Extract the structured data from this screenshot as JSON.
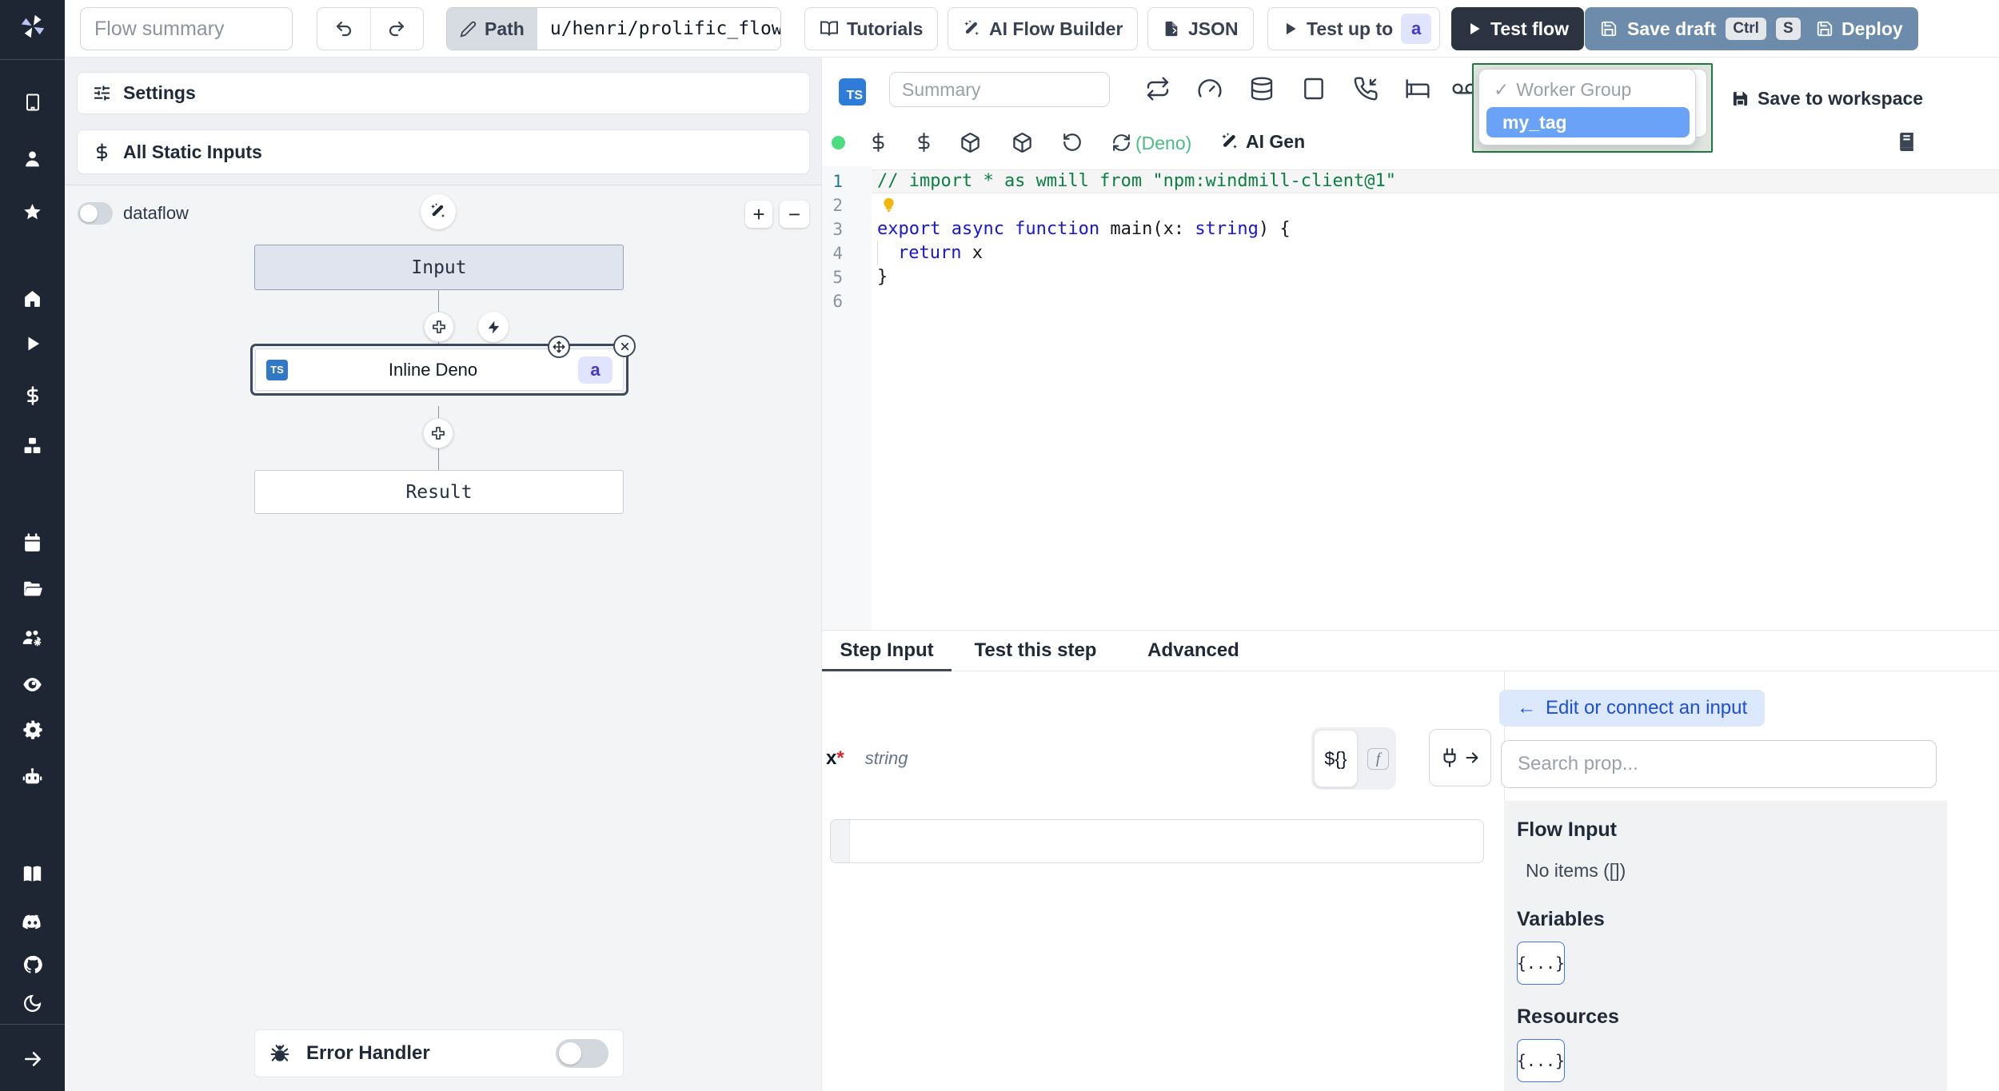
{
  "colors": {
    "sidebar_bg": "#1f2633",
    "steel_blue": "#6d8cab",
    "dark_button": "#2b3440",
    "accent_green_border": "#1c7a3f",
    "selected_option_blue": "#69a2f7",
    "indigo_chip_bg": "#e0e4fd",
    "ts_badge_blue": "#2f7cd8"
  },
  "sidebar": {
    "icons": [
      "windmill-logo",
      "building",
      "user",
      "star",
      "home",
      "play",
      "dollar",
      "boxes",
      "calendar",
      "folder-open",
      "user-group",
      "eye",
      "gear",
      "robot",
      "book",
      "discord",
      "github",
      "moon",
      "arrow-right"
    ]
  },
  "topbar": {
    "flow_summary_placeholder": "Flow summary",
    "path_label": "Path",
    "path_value": "u/henri/prolific_flow",
    "tutorials": "Tutorials",
    "ai_flow_builder": "AI Flow Builder",
    "json": "JSON",
    "test_up_to": "Test up to",
    "test_up_to_target": "a",
    "test_flow": "Test flow",
    "save_draft": "Save draft",
    "kbd_ctrl": "Ctrl",
    "kbd_s": "S",
    "deploy": "Deploy"
  },
  "left_panel": {
    "settings": "Settings",
    "all_static_inputs": "All Static Inputs",
    "dataflow_label": "dataflow",
    "graph": {
      "input_node": "Input",
      "step_lang": "TS",
      "step_node": "Inline Deno",
      "step_id": "a",
      "result_node": "Result"
    },
    "error_handler": "Error Handler"
  },
  "editor": {
    "lang_badge": "TS",
    "summary_placeholder": "Summary",
    "runtime": "(Deno)",
    "ai_gen": "AI Gen",
    "worker_group": {
      "check": "✓",
      "placeholder": "Worker Group",
      "selected": "my_tag"
    },
    "save_to_workspace": "Save to workspace",
    "code": {
      "line_numbers": [
        "1",
        "2",
        "3",
        "4",
        "5",
        "6"
      ],
      "l1": "// import * as wmill from \"npm:windmill-client@1\"",
      "l3_kw": "export async function",
      "l3_p1": " main(x: ",
      "l3_type": "string",
      "l3_p2": ") {",
      "l4_kw": "return",
      "l4_p": " x",
      "l5": "}"
    }
  },
  "bottom": {
    "tabs": {
      "step_input": "Step Input",
      "test_this_step": "Test this step",
      "advanced": "Advanced"
    },
    "field": {
      "name": "x",
      "required": "*",
      "type": "string",
      "expr": "${}",
      "fn": "f"
    },
    "connect": {
      "back_arrow": "←",
      "edit_btn": "Edit or connect an input",
      "search_placeholder": "Search prop...",
      "flow_input": "Flow Input",
      "no_items": "No items ([])",
      "variables": "Variables",
      "resources": "Resources",
      "braces": "{...}"
    }
  }
}
